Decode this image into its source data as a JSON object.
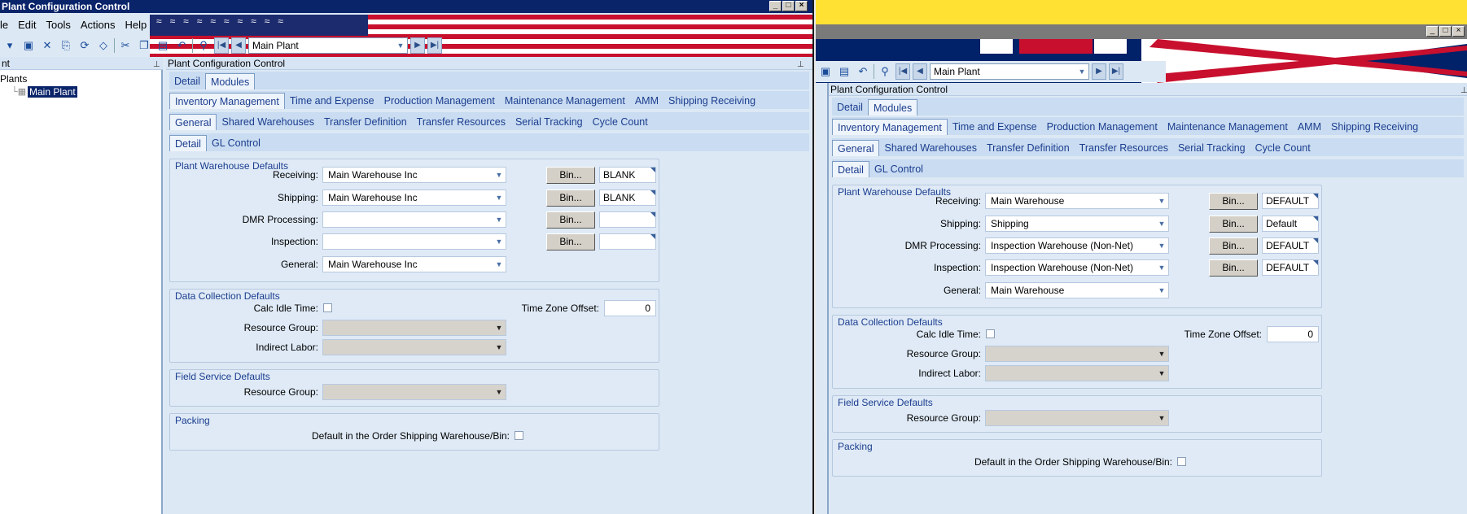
{
  "window1": {
    "title": "Plant Configuration Control",
    "menu": [
      "le",
      "Edit",
      "Tools",
      "Actions",
      "Help"
    ],
    "plant_selector": "Main Plant",
    "tree": {
      "header": "nt",
      "root": "Plants",
      "item": "Main Plant"
    },
    "panel_title": "Plant Configuration Control",
    "top_tabs": [
      "Detail",
      "Modules"
    ],
    "module_tabs": [
      "Inventory Management",
      "Time and Expense",
      "Production Management",
      "Maintenance Management",
      "AMM",
      "Shipping Receiving"
    ],
    "sub_tabs": [
      "General",
      "Shared Warehouses",
      "Transfer Definition",
      "Transfer Resources",
      "Serial Tracking",
      "Cycle Count"
    ],
    "detail_tabs": [
      "Detail",
      "GL Control"
    ],
    "plant_warehouse": {
      "label": "Plant Warehouse Defaults",
      "receiving": {
        "label": "Receiving:",
        "value": "Main Warehouse Inc",
        "bin": "BLANK"
      },
      "shipping": {
        "label": "Shipping:",
        "value": "Main Warehouse Inc",
        "bin": "BLANK"
      },
      "dmr": {
        "label": "DMR Processing:",
        "value": "",
        "bin": ""
      },
      "inspection": {
        "label": "Inspection:",
        "value": "",
        "bin": ""
      },
      "general": {
        "label": "General:",
        "value": "Main Warehouse Inc"
      },
      "bin_button": "Bin..."
    },
    "data_collection": {
      "label": "Data Collection Defaults",
      "calc_idle": "Calc Idle Time:",
      "tz_label": "Time Zone Offset:",
      "tz_value": "0",
      "resource_group": "Resource Group:",
      "indirect_labor": "Indirect Labor:"
    },
    "field_service": {
      "label": "Field Service Defaults",
      "resource_group": "Resource Group:"
    },
    "packing": {
      "label": "Packing",
      "default_label": "Default in the Order Shipping Warehouse/Bin:"
    }
  },
  "window2": {
    "plant_selector": "Main Plant",
    "panel_title": "Plant Configuration Control",
    "top_tabs": [
      "Detail",
      "Modules"
    ],
    "module_tabs": [
      "Inventory Management",
      "Time and Expense",
      "Production Management",
      "Maintenance Management",
      "AMM",
      "Shipping Receiving"
    ],
    "sub_tabs": [
      "General",
      "Shared Warehouses",
      "Transfer Definition",
      "Transfer Resources",
      "Serial Tracking",
      "Cycle Count"
    ],
    "detail_tabs": [
      "Detail",
      "GL Control"
    ],
    "plant_warehouse": {
      "label": "Plant Warehouse Defaults",
      "receiving": {
        "label": "Receiving:",
        "value": "Main Warehouse",
        "bin": "DEFAULT"
      },
      "shipping": {
        "label": "Shipping:",
        "value": "Shipping",
        "bin": "Default"
      },
      "dmr": {
        "label": "DMR Processing:",
        "value": "Inspection Warehouse (Non-Net)",
        "bin": "DEFAULT"
      },
      "inspection": {
        "label": "Inspection:",
        "value": "Inspection Warehouse (Non-Net)",
        "bin": "DEFAULT"
      },
      "general": {
        "label": "General:",
        "value": "Main Warehouse"
      },
      "bin_button": "Bin..."
    },
    "data_collection": {
      "label": "Data Collection Defaults",
      "calc_idle": "Calc Idle Time:",
      "tz_label": "Time Zone Offset:",
      "tz_value": "0",
      "resource_group": "Resource Group:",
      "indirect_labor": "Indirect Labor:"
    },
    "field_service": {
      "label": "Field Service Defaults",
      "resource_group": "Resource Group:"
    },
    "packing": {
      "label": "Packing",
      "default_label": "Default in the Order Shipping Warehouse/Bin:"
    }
  }
}
